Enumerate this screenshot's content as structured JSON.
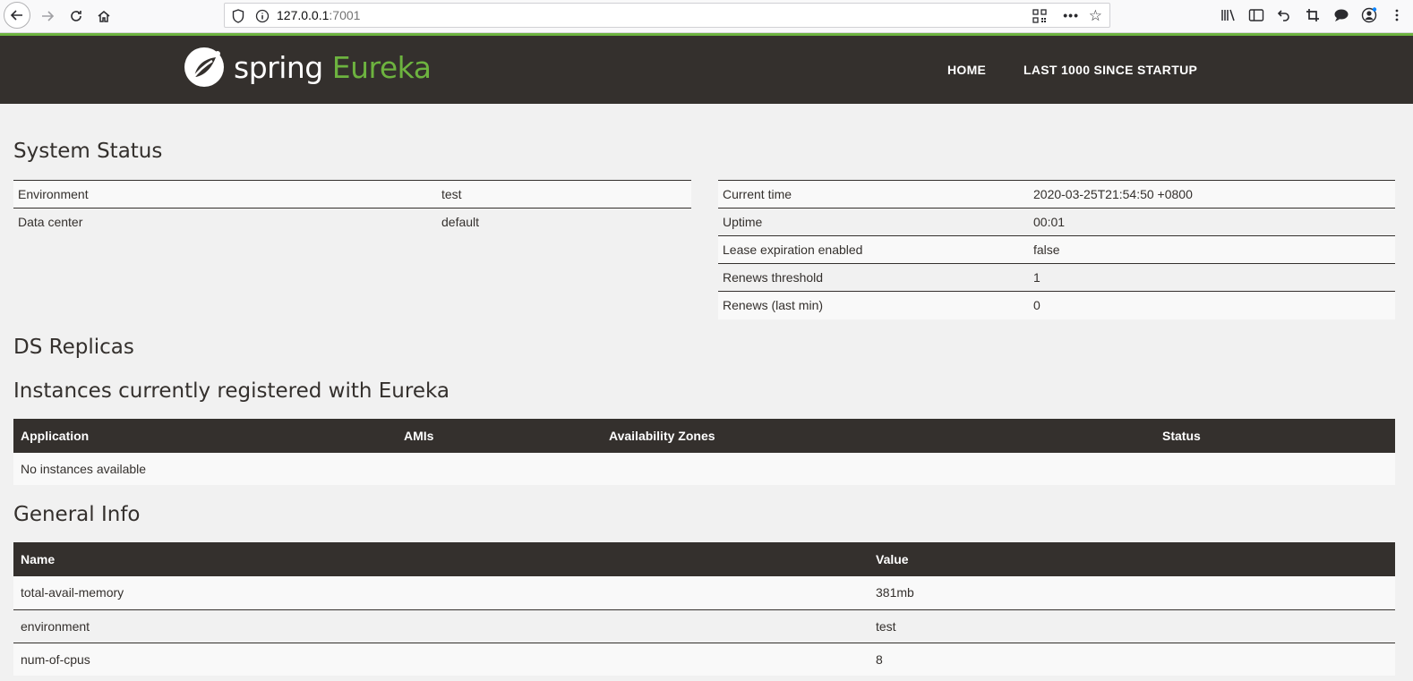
{
  "browser": {
    "url_host": "127.0.0.1",
    "url_port": ":7001",
    "more_label": "•••"
  },
  "brand": {
    "spring": "spring",
    "eureka": "Eureka"
  },
  "nav": {
    "home": "HOME",
    "last1000": "LAST 1000 SINCE STARTUP"
  },
  "system_status": {
    "title": "System Status",
    "left": [
      {
        "label": "Environment",
        "value": "test"
      },
      {
        "label": "Data center",
        "value": "default"
      }
    ],
    "right": [
      {
        "label": "Current time",
        "value": "2020-03-25T21:54:50 +0800"
      },
      {
        "label": "Uptime",
        "value": "00:01"
      },
      {
        "label": "Lease expiration enabled",
        "value": "false"
      },
      {
        "label": "Renews threshold",
        "value": "1"
      },
      {
        "label": "Renews (last min)",
        "value": "0"
      }
    ]
  },
  "ds_replicas": {
    "title": "DS Replicas"
  },
  "instances": {
    "title": "Instances currently registered with Eureka",
    "headers": [
      "Application",
      "AMIs",
      "Availability Zones",
      "Status"
    ],
    "empty": "No instances available"
  },
  "general_info": {
    "title": "General Info",
    "headers": [
      "Name",
      "Value"
    ],
    "rows": [
      {
        "name": "total-avail-memory",
        "value": "381mb"
      },
      {
        "name": "environment",
        "value": "test"
      },
      {
        "name": "num-of-cpus",
        "value": "8"
      }
    ]
  },
  "colors": {
    "brand_green": "#6db33f",
    "dark": "#34302d"
  }
}
